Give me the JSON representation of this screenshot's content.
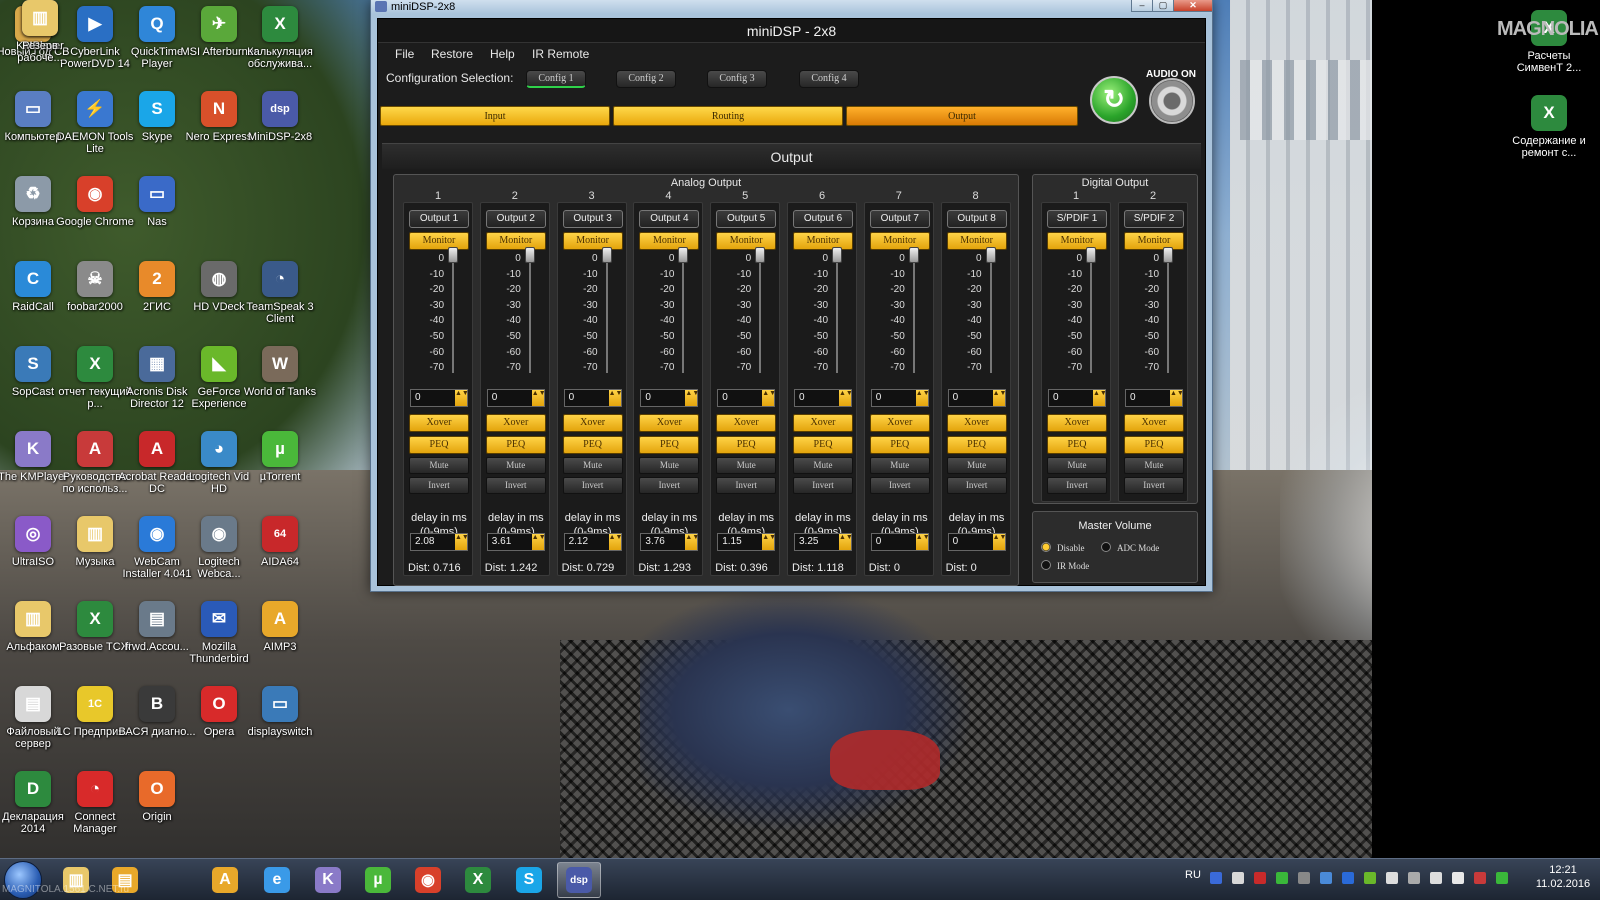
{
  "desktop": {
    "icons": [
      {
        "label": "Новый Год СВ",
        "color": "#d8a84a",
        "glyph": "▤"
      },
      {
        "label": "CyberLink PowerDVD 14",
        "color": "#2a6fc4",
        "glyph": "▶"
      },
      {
        "label": "QuickTime Player",
        "color": "#2f86d8",
        "glyph": "Q"
      },
      {
        "label": "MSI Afterburner",
        "color": "#5aa83a",
        "glyph": "✈"
      },
      {
        "label": "Калькуляция обслужива...",
        "color": "#2d8a3e",
        "glyph": "X"
      },
      {
        "label": "Компьютер",
        "color": "#5a7ec2",
        "glyph": "▭"
      },
      {
        "label": "DAEMON Tools Lite",
        "color": "#3a78d0",
        "glyph": "⚡"
      },
      {
        "label": "Skype",
        "color": "#1aa6e8",
        "glyph": "S"
      },
      {
        "label": "Nero Express",
        "color": "#d8502a",
        "glyph": "N"
      },
      {
        "label": "MiniDSP-2x8",
        "color": "#4a5aa8",
        "glyph": "dsp"
      },
      {
        "label": "Корзина",
        "color": "#8c9aa8",
        "glyph": "♻"
      },
      {
        "label": "Google Chrome",
        "color": "#d8402a",
        "glyph": "◉"
      },
      {
        "label": "Nas",
        "color": "#3a6ac8",
        "glyph": "▭"
      },
      {
        "label": "RaidCall",
        "color": "#2a8ad8",
        "glyph": "C"
      },
      {
        "label": "foobar2000",
        "color": "#8a8a8a",
        "glyph": "☠"
      },
      {
        "label": "2ГИС",
        "color": "#e88a2a",
        "glyph": "2"
      },
      {
        "label": "HD VDeck",
        "color": "#6a6a6a",
        "glyph": "◍"
      },
      {
        "label": "TeamSpeak 3 Client",
        "color": "#3a5a8a",
        "glyph": "◔"
      },
      {
        "label": "SopCast",
        "color": "#3a7ab8",
        "glyph": "S"
      },
      {
        "label": "отчет текущий р...",
        "color": "#2d8a3e",
        "glyph": "X"
      },
      {
        "label": "Acronis Disk Director 12",
        "color": "#4a6a9a",
        "glyph": "▦"
      },
      {
        "label": "GeForce Experience",
        "color": "#6ab82a",
        "glyph": "◣"
      },
      {
        "label": "World of Tanks",
        "color": "#7a6a5a",
        "glyph": "W"
      },
      {
        "label": "The KMPlayer",
        "color": "#8a7ac8",
        "glyph": "K"
      },
      {
        "label": "Руководство по использ...",
        "color": "#c83a3a",
        "glyph": "A"
      },
      {
        "label": "Acrobat Reader DC",
        "color": "#c8282a",
        "glyph": "A"
      },
      {
        "label": "Logitech Vid HD",
        "color": "#3a8ac8",
        "glyph": "◕"
      },
      {
        "label": "µTorrent",
        "color": "#4ab83a",
        "glyph": "µ"
      },
      {
        "label": "UltraISO",
        "color": "#8a5ac8",
        "glyph": "◎"
      },
      {
        "label": "Музыка",
        "color": "#e8c86a",
        "glyph": "▥"
      },
      {
        "label": "WebCam Installer 4.041",
        "color": "#2a7ad8",
        "glyph": "◉"
      },
      {
        "label": "Logitech Webca...",
        "color": "#6a7a8a",
        "glyph": "◉"
      },
      {
        "label": "AIDA64",
        "color": "#c8282a",
        "glyph": "64"
      },
      {
        "label": "Альфаком",
        "color": "#e8c86a",
        "glyph": "▥"
      },
      {
        "label": "Разовые ТСЖ",
        "color": "#2d8a3e",
        "glyph": "X"
      },
      {
        "label": "frwd.Accou...",
        "color": "#6a7a8a",
        "glyph": "▤"
      },
      {
        "label": "Mozilla Thunderbird",
        "color": "#2a5ab8",
        "glyph": "✉"
      },
      {
        "label": "AIMP3",
        "color": "#e8a82a",
        "glyph": "A"
      },
      {
        "label": "Файловый сервер",
        "color": "#d8d8d8",
        "glyph": "▤"
      },
      {
        "label": "1С Предприя...",
        "color": "#e8c82a",
        "glyph": "1С"
      },
      {
        "label": "ВАСЯ диагно...",
        "color": "#3a3a3a",
        "glyph": "В"
      },
      {
        "label": "Opera",
        "color": "#d82a2a",
        "glyph": "O"
      },
      {
        "label": "displayswitch",
        "color": "#3a7ab8",
        "glyph": "▭"
      },
      {
        "label": "Декларация 2014",
        "color": "#2d8a3e",
        "glyph": "D"
      },
      {
        "label": "Connect Manager",
        "color": "#d82a2a",
        "glyph": "◔"
      },
      {
        "label": "Origin",
        "color": "#e86a2a",
        "glyph": "O"
      },
      {
        "label": "KMPlayer",
        "color": "#8a7ac8",
        "glyph": "K"
      },
      {
        "label": "Резерв рабоче...",
        "color": "#e8c86a",
        "glyph": "▥"
      }
    ],
    "right_icons": [
      {
        "label": "Расчеты СимвенТ 2...",
        "color": "#2d8a3e",
        "glyph": "X"
      },
      {
        "label": "Содержание и ремонт с...",
        "color": "#2d8a3e",
        "glyph": "X"
      }
    ],
    "right_logo": "MAGNOLIA"
  },
  "window": {
    "title": "miniDSP-2x8",
    "controls": [
      "‒",
      "▢",
      "✕"
    ]
  },
  "app": {
    "title": "miniDSP - 2x8",
    "menu": [
      "File",
      "Restore",
      "Help",
      "IR Remote"
    ],
    "config_label": "Configuration Selection:",
    "configs": [
      "Config 1",
      "Config 2",
      "Config 3",
      "Config 4"
    ],
    "active_config": 0,
    "tabs": [
      "Input",
      "Routing",
      "Output"
    ],
    "active_tab": 2,
    "audio_on": "AUDIO ON",
    "refresh_glyph": "↻",
    "section_title": "Output",
    "analog_title": "Analog Output",
    "digital_title": "Digital Output",
    "scale": [
      "0",
      "-10",
      "-20",
      "-30",
      "-40",
      "-50",
      "-60",
      "-70"
    ],
    "labels": {
      "monitor": "Monitor",
      "xover": "Xover",
      "peq": "PEQ",
      "mute": "Mute",
      "invert": "Invert",
      "delay": "delay in ms (0-9ms)",
      "dist_prefix": "Dist: "
    },
    "analog_channels": [
      {
        "num": "1",
        "name": "Output 1",
        "gain": "0",
        "delay": "2.08",
        "dist": "0.716"
      },
      {
        "num": "2",
        "name": "Output 2",
        "gain": "0",
        "delay": "3.61",
        "dist": "1.242"
      },
      {
        "num": "3",
        "name": "Output 3",
        "gain": "0",
        "delay": "2.12",
        "dist": "0.729"
      },
      {
        "num": "4",
        "name": "Output 4",
        "gain": "0",
        "delay": "3.76",
        "dist": "1.293"
      },
      {
        "num": "5",
        "name": "Output 5",
        "gain": "0",
        "delay": "1.15",
        "dist": "0.396"
      },
      {
        "num": "6",
        "name": "Output 6",
        "gain": "0",
        "delay": "3.25",
        "dist": "1.118"
      },
      {
        "num": "7",
        "name": "Output 7",
        "gain": "0",
        "delay": "0",
        "dist": "0"
      },
      {
        "num": "8",
        "name": "Output 8",
        "gain": "0",
        "delay": "0",
        "dist": "0"
      }
    ],
    "digital_channels": [
      {
        "num": "1",
        "name": "S/PDIF 1",
        "gain": "0"
      },
      {
        "num": "2",
        "name": "S/PDIF 2",
        "gain": "0"
      }
    ],
    "master": {
      "title": "Master Volume",
      "options": [
        "Disable",
        "ADC Mode",
        "IR Mode"
      ],
      "selected": 0
    }
  },
  "taskbar": {
    "items": [
      {
        "name": "explorer",
        "color": "#e8c86a",
        "glyph": "▥"
      },
      {
        "name": "taskbar-app-2",
        "color": "#e8a82a",
        "glyph": "▤"
      },
      {
        "name": "aimp",
        "color": "#e8a82a",
        "glyph": "A"
      },
      {
        "name": "internet-explorer",
        "color": "#3a9ae8",
        "glyph": "e"
      },
      {
        "name": "kmplayer",
        "color": "#8a7ac8",
        "glyph": "K"
      },
      {
        "name": "utorrent",
        "color": "#4ab83a",
        "glyph": "µ"
      },
      {
        "name": "chrome",
        "color": "#d8402a",
        "glyph": "◉"
      },
      {
        "name": "excel",
        "color": "#2d8a3e",
        "glyph": "X"
      },
      {
        "name": "skype",
        "color": "#1aa6e8",
        "glyph": "S"
      },
      {
        "name": "minidsp",
        "color": "#4a5aa8",
        "glyph": "dsp"
      }
    ],
    "active": 9,
    "lang": "RU",
    "time": "12:21",
    "date": "11.02.2016"
  },
  "watermark": "MAGNITOLA.1561 C.NET.ru"
}
